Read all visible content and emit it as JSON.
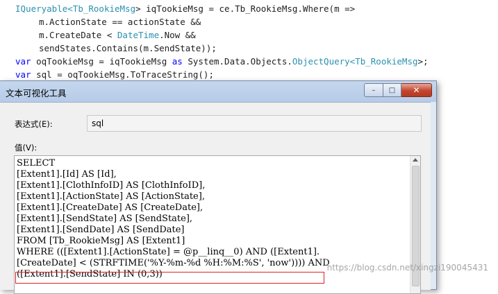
{
  "editor": {
    "lines": [
      {
        "indent": 22,
        "tokens": [
          {
            "t": "IQueryable<",
            "c": "ty"
          },
          {
            "t": "Tb_RookieMsg",
            "c": "ty"
          },
          {
            "t": "> iqTookieMsg = ce.Tb_RookieMsg.Where(m =>",
            "c": "tx"
          }
        ]
      },
      {
        "indent": 56,
        "tokens": [
          {
            "t": "m.ActionState == actionState &&",
            "c": "tx"
          }
        ]
      },
      {
        "indent": 56,
        "tokens": [
          {
            "t": "m.CreateDate < ",
            "c": "tx"
          },
          {
            "t": "DateTime",
            "c": "ty"
          },
          {
            "t": ".Now &&",
            "c": "tx"
          }
        ]
      },
      {
        "indent": 56,
        "tokens": [
          {
            "t": "sendStates.Contains(m.SendState));",
            "c": "tx"
          }
        ]
      },
      {
        "indent": 22,
        "tokens": [
          {
            "t": "var",
            "c": "kw"
          },
          {
            "t": " oqTookieMsg = iqTookieMsg ",
            "c": "tx"
          },
          {
            "t": "as",
            "c": "kw"
          },
          {
            "t": " System.Data.Objects.",
            "c": "tx"
          },
          {
            "t": "ObjectQuery<",
            "c": "ty"
          },
          {
            "t": "Tb_RookieMsg",
            "c": "ty"
          },
          {
            "t": ">;",
            "c": "tx"
          }
        ]
      },
      {
        "indent": 22,
        "tokens": [
          {
            "t": "var",
            "c": "kw"
          },
          {
            "t": " sql = oqTookieMsg.ToTraceString();",
            "c": "tx"
          }
        ]
      }
    ]
  },
  "dialog": {
    "title": "文本可视化工具",
    "buttons": {
      "minimize": "–",
      "maximize": "□",
      "close": "✕"
    },
    "expression_label": "表达式(E):",
    "expression_value": "sql",
    "value_label": "值(V):",
    "value_lines": [
      "SELECT",
      "[Extent1].[Id] AS [Id],",
      "[Extent1].[ClothInfoID] AS [ClothInfoID],",
      "[Extent1].[ActionState] AS [ActionState],",
      "[Extent1].[CreateDate] AS [CreateDate],",
      "[Extent1].[SendState] AS [SendState],",
      "[Extent1].[SendDate] AS [SendDate]",
      "FROM [Tb_RookieMsg] AS [Extent1]",
      "WHERE (([Extent1].[ActionState] = @p__linq__0) AND ([Extent1].",
      "[CreateDate] < (STRFTIME('%Y-%m-%d %H:%M:%S', 'now')))) AND",
      "([Extent1].[SendState] IN (0,3))"
    ]
  },
  "watermark": "https://blog.csdn.net/xingzi190045431"
}
